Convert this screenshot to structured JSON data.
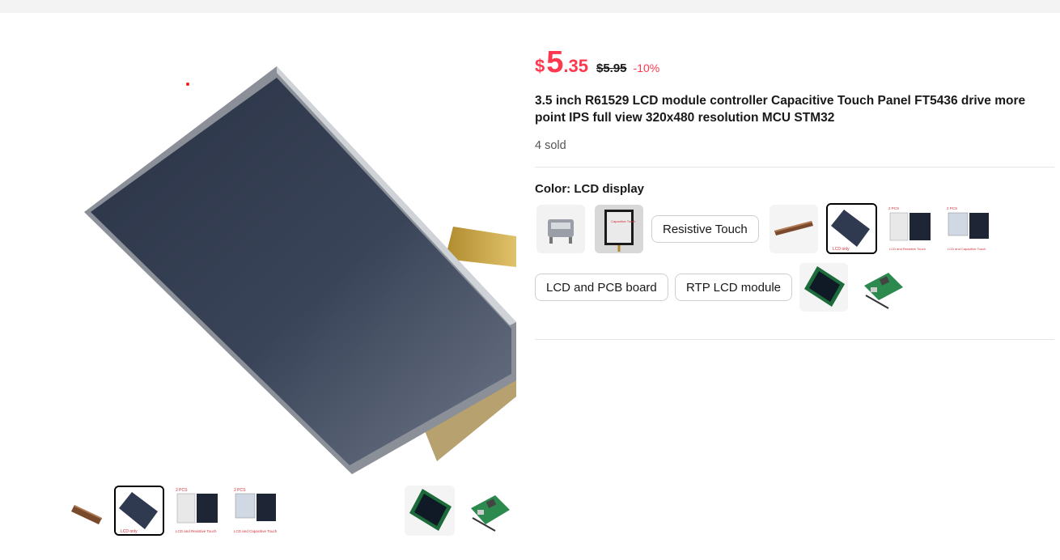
{
  "price": {
    "currency": "$",
    "integer": "5",
    "decimal": ".35",
    "original": "$5.95",
    "discount": "-10%"
  },
  "product": {
    "title": "3.5 inch R61529 LCD module controller Capacitive Touch Panel FT5436 drive more point IPS full view 320x480 resolution MCU STM32",
    "sold": "4 sold"
  },
  "sku": {
    "label": "Color: LCD display",
    "options": [
      {
        "type": "image",
        "icon": "connector-icon"
      },
      {
        "type": "image",
        "icon": "capacitive-touch-panel-icon",
        "image_text": "Capacitive Touch"
      },
      {
        "type": "text",
        "label": "Resistive Touch"
      },
      {
        "type": "image",
        "icon": "ribbon-cable-icon"
      },
      {
        "type": "image",
        "icon": "lcd-only-icon",
        "image_text": "LCD only",
        "selected": true
      },
      {
        "type": "image",
        "icon": "lcd-resistive-touch-icon",
        "image_text": "LCD and Resistive Touch",
        "badge": "2 PCS"
      },
      {
        "type": "image",
        "icon": "lcd-capacitive-touch-icon",
        "image_text": "LCD and Capacitive Touch",
        "badge": "2 PCS"
      },
      {
        "type": "text",
        "label": "LCD and PCB board"
      },
      {
        "type": "text",
        "label": "RTP LCD module"
      },
      {
        "type": "image",
        "icon": "lcd-pcb-board-icon"
      },
      {
        "type": "image",
        "icon": "pcb-assembly-icon"
      }
    ]
  },
  "gallery": {
    "main_icon": "lcd-panel-main-image",
    "thumbnails": [
      {
        "icon": "ribbon-cable-thumb-icon"
      },
      {
        "icon": "lcd-only-thumb-icon",
        "image_text": "LCD only",
        "selected": true
      },
      {
        "icon": "lcd-resistive-thumb-icon",
        "image_text": "LCD and Resistive Touch",
        "badge": "2 PCS"
      },
      {
        "icon": "lcd-capacitive-thumb-icon",
        "image_text": "LCD and Capacitive Touch",
        "badge": "2 PCS"
      },
      {
        "icon": "lcd-pcb-thumb-icon"
      },
      {
        "icon": "pcb-assembly-thumb-icon"
      }
    ]
  },
  "colors": {
    "accent": "#fd384f",
    "text": "#191919",
    "selected_border": "#000000"
  }
}
